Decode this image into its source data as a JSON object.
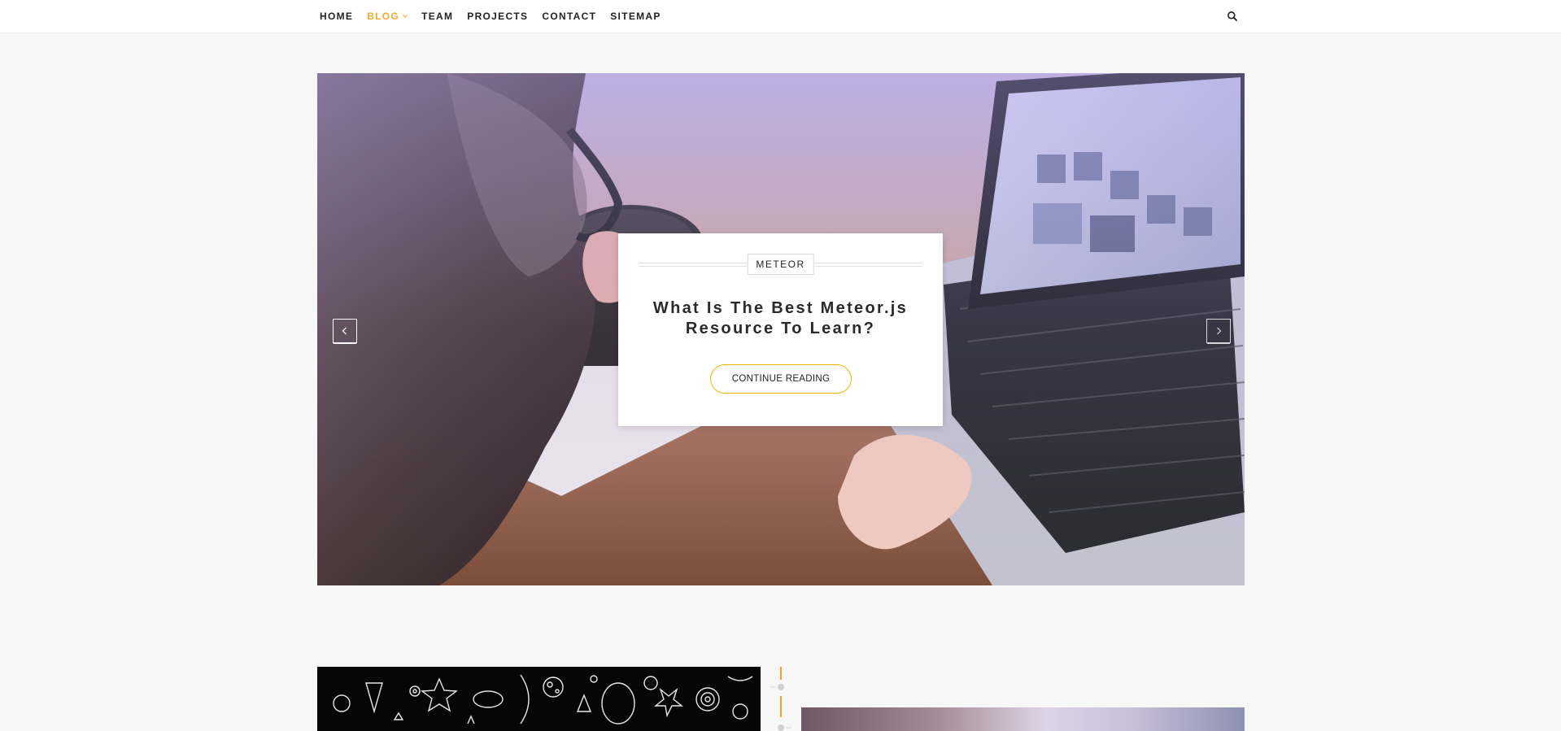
{
  "nav": {
    "items": [
      {
        "label": "HOME",
        "active": false
      },
      {
        "label": "BLOG",
        "active": true,
        "has_dropdown": true
      },
      {
        "label": "TEAM",
        "active": false
      },
      {
        "label": "PROJECTS",
        "active": false
      },
      {
        "label": "CONTACT",
        "active": false
      },
      {
        "label": "SITEMAP",
        "active": false
      }
    ],
    "search_icon": "search-icon"
  },
  "slider": {
    "category": "METEOR",
    "title": "What Is The Best Meteor.js Resource To Learn?",
    "cta_label": "CONTINUE READING",
    "prev_icon": "chevron-left-icon",
    "next_icon": "chevron-right-icon"
  },
  "colors": {
    "accent": "#f0a92e",
    "button_border": "#f0b400",
    "page_bg": "#f7f7f7"
  }
}
